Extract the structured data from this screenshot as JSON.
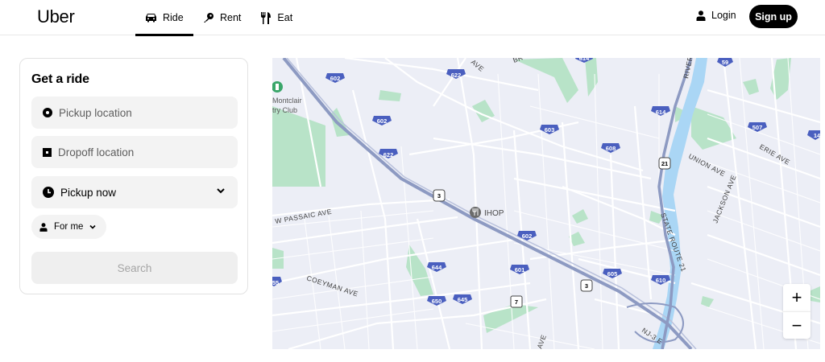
{
  "header": {
    "logo": "Uber",
    "nav": [
      {
        "label": "Ride",
        "icon": "car-icon"
      },
      {
        "label": "Rent",
        "icon": "key-icon"
      },
      {
        "label": "Eat",
        "icon": "fork-knife-icon"
      }
    ],
    "login": "Login",
    "signup": "Sign up"
  },
  "panel": {
    "title": "Get a ride",
    "pickup_placeholder": "Pickup location",
    "dropoff_placeholder": "Dropoff location",
    "time_selected": "Pickup now",
    "rider_selected": "For me",
    "search_label": "Search"
  },
  "map": {
    "poi": "IHOP",
    "club": [
      "Montclair",
      "try Club"
    ],
    "streets": [
      "W PASSAIC AVE",
      "COEYMAN AVE",
      "UNION AVE",
      "JACKSON AVE",
      "ERIE AVE",
      "STATE ROUTE 21",
      "RIVER",
      "AVE",
      "AVE",
      "BR",
      "NJ-3 E"
    ],
    "shields": [
      "602",
      "622",
      "602",
      "622",
      "603",
      "608",
      "614",
      "507",
      "59",
      "602",
      "644",
      "601",
      "605",
      "610",
      "650",
      "645",
      "21",
      "3",
      "3",
      "7",
      "14",
      "614",
      "55"
    ],
    "zoom_in": "+",
    "zoom_out": "−"
  },
  "colors": {
    "brand": "#000000",
    "map_bg": "#eceef6",
    "park": "#b8e3c8",
    "water": "#aad6f5",
    "highway": "#8d9ac2",
    "shield": "#4a5fbf"
  }
}
